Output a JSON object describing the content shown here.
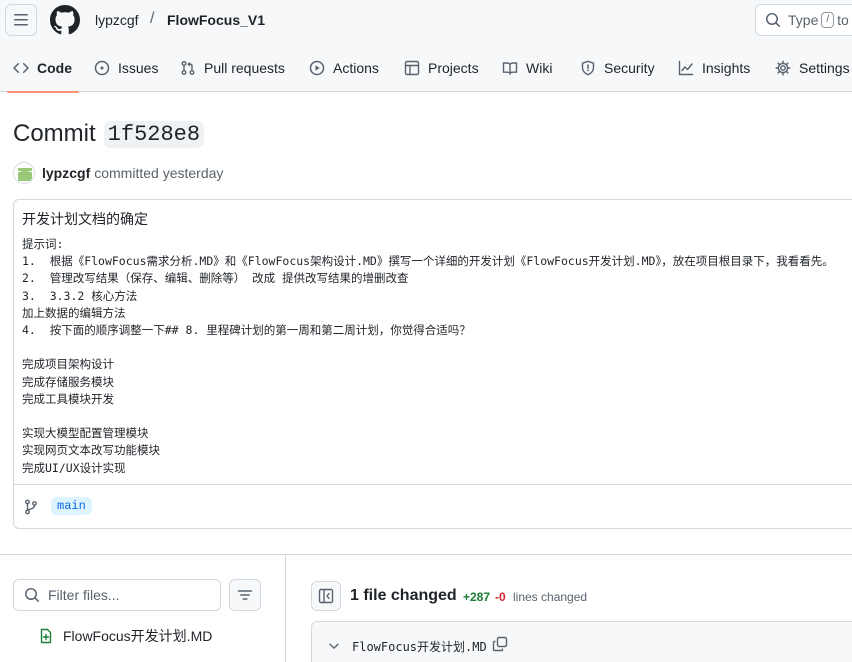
{
  "header": {
    "owner": "lypzcgf",
    "separator": "/",
    "repo": "FlowFocus_V1",
    "search_prefix": "Type",
    "search_key": "/",
    "search_suffix": "to"
  },
  "tabs": [
    {
      "label": "Code",
      "icon": "code-icon",
      "active": true
    },
    {
      "label": "Issues",
      "icon": "issue-icon",
      "active": false
    },
    {
      "label": "Pull requests",
      "icon": "pull-request-icon",
      "active": false
    },
    {
      "label": "Actions",
      "icon": "play-icon",
      "active": false
    },
    {
      "label": "Projects",
      "icon": "table-icon",
      "active": false
    },
    {
      "label": "Wiki",
      "icon": "book-icon",
      "active": false
    },
    {
      "label": "Security",
      "icon": "shield-icon",
      "active": false
    },
    {
      "label": "Insights",
      "icon": "graph-icon",
      "active": false
    },
    {
      "label": "Settings",
      "icon": "gear-icon",
      "active": false
    }
  ],
  "commit": {
    "heading": "Commit",
    "sha": "1f528e8",
    "author": "lypzcgf",
    "action_text": "committed yesterday",
    "message_title": "开发计划文档的确定",
    "message_body": "提示词:\n1.  根据《FlowFocus需求分析.MD》和《FlowFocus架构设计.MD》撰写一个详细的开发计划《FlowFocus开发计划.MD》，放在项目根目录下，我看看先。\n2.  管理改写结果（保存、编辑、删除等） 改成 提供改写结果的增删改查\n3.  3.3.2 核心方法\n加上数据的编辑方法\n4.  按下面的顺序调整一下## 8. 里程碑计划的第一周和第二周计划，你觉得合适吗？\n\n完成项目架构设计\n完成存储服务模块\n完成工具模块开发\n\n实现大模型配置管理模块\n实现网页文本改写功能模块\n完成UI/UX设计实现",
    "branch": "main"
  },
  "file_tree": {
    "filter_placeholder": "Filter files...",
    "files": [
      {
        "name": "FlowFocus开发计划.MD",
        "status": "added"
      }
    ]
  },
  "diff_summary": {
    "files_changed": "1 file changed",
    "additions": "+287",
    "deletions": "-0",
    "lines_changed": "lines changed"
  },
  "diff_file": {
    "path": "FlowFocus开发计划.MD"
  },
  "colors": {
    "accent_underline": "#fd8c73",
    "additions": "#1a7f37",
    "deletions": "#d1242f",
    "branch_bg": "#ddf4ff",
    "branch_text": "#0969da"
  }
}
